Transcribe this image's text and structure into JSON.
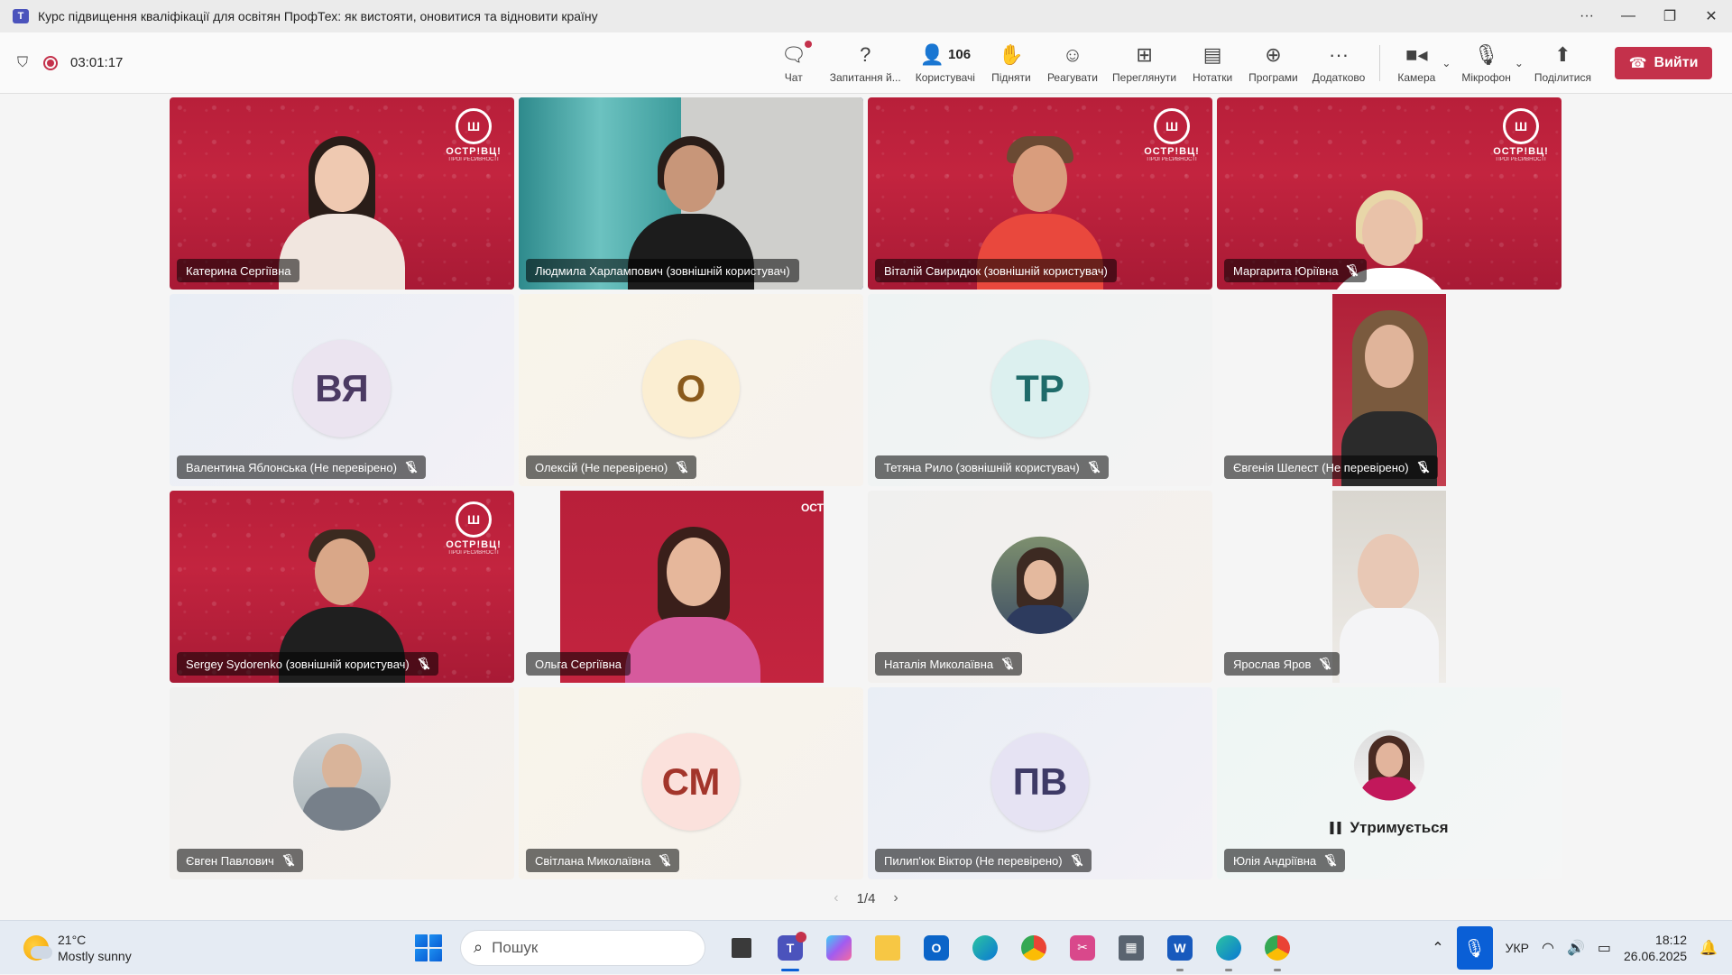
{
  "window": {
    "title": "Курс підвищення кваліфікації для освітян ПрофТех: як вистояти, оновитися та відновити країну",
    "more": "···",
    "minimize": "—",
    "maximize": "❐",
    "close": "✕"
  },
  "meeting": {
    "timer": "03:01:17",
    "tools": [
      {
        "label": "Чат",
        "icon": "chat-icon"
      },
      {
        "label": "Запитання й...",
        "icon": "question-icon"
      },
      {
        "label": "Користувачі",
        "icon": "people-icon",
        "count": "106"
      },
      {
        "label": "Підняти",
        "icon": "hand-icon"
      },
      {
        "label": "Реагувати",
        "icon": "smile-icon"
      },
      {
        "label": "Переглянути",
        "icon": "grid-icon"
      },
      {
        "label": "Нотатки",
        "icon": "notes-icon"
      },
      {
        "label": "Програми",
        "icon": "plus-icon"
      },
      {
        "label": "Додатково",
        "icon": "more-icon"
      }
    ],
    "camera_label": "Камера",
    "mic_label": "Мікрофон",
    "share_label": "Поділитися",
    "leave_label": "Вийти",
    "leave_color": "#c4314b"
  },
  "participants": [
    {
      "name": "Катерина Сергіївна",
      "type": "video",
      "muted": false
    },
    {
      "name": "Людмила Харлампович (зовнішній користувач)",
      "type": "video",
      "muted": false,
      "speaking": true
    },
    {
      "name": "Віталій Свиридюк (зовнішній користувач)",
      "type": "video",
      "muted": false
    },
    {
      "name": "Маргарита Юріївна",
      "type": "video",
      "muted": true
    },
    {
      "name": "Валентина Яблонська (Не перевірено)",
      "type": "initials",
      "initials": "ВЯ",
      "muted": true,
      "avatar_bg": "#ebe4f0",
      "avatar_fg": "#4b3a63"
    },
    {
      "name": "Олексій (Не перевірено)",
      "type": "initials",
      "initials": "О",
      "muted": true,
      "avatar_bg": "#fbeed2",
      "avatar_fg": "#8a5a1c"
    },
    {
      "name": "Тетяна Рило (зовнішній користувач)",
      "type": "initials",
      "initials": "ТР",
      "muted": true,
      "avatar_bg": "#dcf0ef",
      "avatar_fg": "#1f6b6a"
    },
    {
      "name": "Євгенія Шелест (Не перевірено)",
      "type": "video",
      "muted": true
    },
    {
      "name": "Sergey Sydorenko (зовнішній користувач)",
      "type": "video",
      "muted": true
    },
    {
      "name": "Ольга Сергіївна",
      "type": "video",
      "muted": false
    },
    {
      "name": "Наталія Миколаївна",
      "type": "photo",
      "muted": true
    },
    {
      "name": "Ярослав Яров",
      "type": "video",
      "muted": true
    },
    {
      "name": "Євген Павлович",
      "type": "photo",
      "muted": true
    },
    {
      "name": "Світлана Миколаївна",
      "type": "initials",
      "initials": "СМ",
      "muted": true,
      "avatar_bg": "#fbe1dc",
      "avatar_fg": "#a3352b"
    },
    {
      "name": "Пилип'юк Віктор (Не перевірено)",
      "type": "initials",
      "initials": "ПВ",
      "muted": true,
      "avatar_bg": "#e6e3f3",
      "avatar_fg": "#3e3a66"
    },
    {
      "name": "Юлія Андріївна",
      "type": "photo",
      "muted": true,
      "status": "Утримується"
    }
  ],
  "brand": {
    "logo_text": "ОСТР!ВЦ!",
    "logo_mark": "Ш",
    "logo_sub": "ПРОГРЕСИВНОСТІ"
  },
  "pager": {
    "label": "1/4",
    "prev": "‹",
    "next": "›"
  },
  "taskbar": {
    "weather_temp": "21°C",
    "weather_desc": "Mostly sunny",
    "search_placeholder": "Пошук",
    "lang": "УКР",
    "time": "18:12",
    "date": "26.06.2025"
  }
}
